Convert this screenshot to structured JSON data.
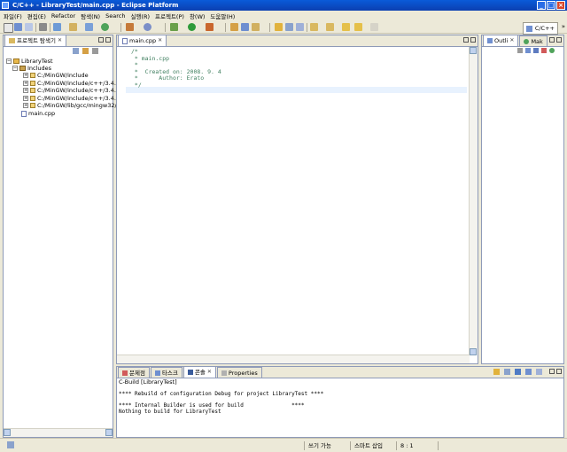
{
  "window": {
    "title": "C/C++ - LibraryTest/main.cpp - Eclipse Platform"
  },
  "menu": [
    "파일(F)",
    "편집(E)",
    "Refactor",
    "탐색(N)",
    "Search",
    "실행(R)",
    "프로젝트(P)",
    "창(W)",
    "도움말(H)"
  ],
  "toolbar": {
    "perspective_label": "C/C++",
    "overflow": "»"
  },
  "explorer": {
    "tab_label": "프로젝트 탐색기",
    "project": "LibraryTest",
    "includes": "Includes",
    "include_paths": [
      "C:/MinGW/include",
      "C:/MinGW/include/c++/3.4.5",
      "C:/MinGW/include/c++/3.4.5",
      "C:/MinGW/include/c++/3.4.5",
      "C:/MinGW/lib/gcc/mingw32/"
    ],
    "file": "main.cpp"
  },
  "editor": {
    "tab_label": "main.cpp",
    "lines": [
      "/*",
      " * main.cpp",
      " *",
      " *  Created on: 2008. 9. 4",
      " *      Author: Erato",
      " */"
    ]
  },
  "outline": {
    "tab1": "Outli",
    "tab2": "Mak"
  },
  "bottom": {
    "tabs": [
      "문제점",
      "타스크",
      "콘솔",
      "Properties"
    ],
    "console_title": "C-Build [LibraryTest]",
    "console_lines": [
      "**** Rebuild of configuration Debug for project LibraryTest ****",
      "",
      "**** Internal Builder is used for build               ****",
      "Nothing to build for LibraryTest"
    ]
  },
  "status": {
    "writable": "쓰기 가능",
    "insert_mode": "스마트 삽입",
    "position": "8 : 1"
  }
}
